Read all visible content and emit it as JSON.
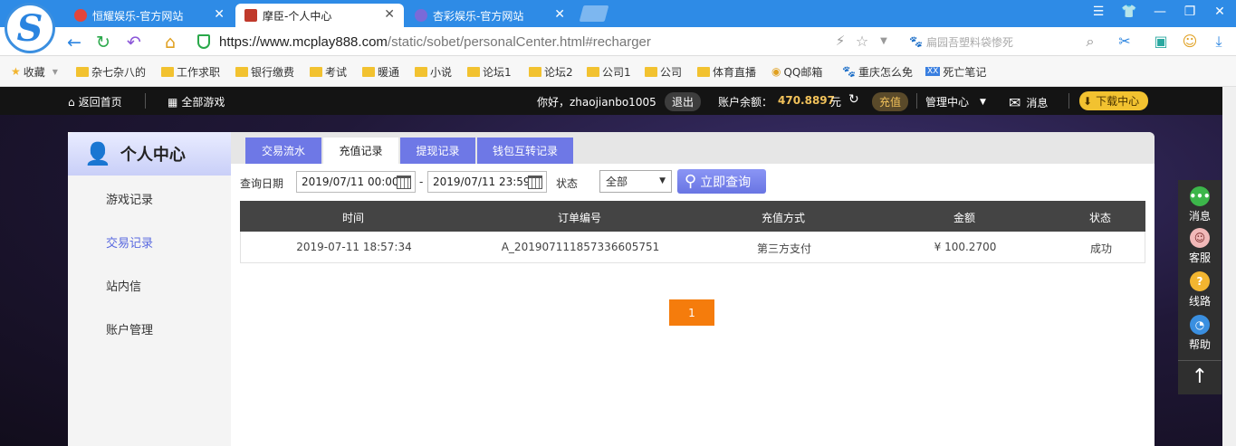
{
  "browser": {
    "logo_glyph": "S",
    "tabs": [
      {
        "label": "恒耀娱乐-官方网站",
        "close": "✕",
        "icon_color": "#e2453c"
      },
      {
        "label": "摩臣-个人中心",
        "close": "✕",
        "icon_color": "#c0392b"
      },
      {
        "label": "杏彩娱乐-官方网站",
        "close": "✕",
        "icon_color": "#7a6ad8"
      }
    ],
    "url": {
      "host": "https://www.mcplay888.com",
      "path": "/static/sobet/personalCenter.html#recharger"
    },
    "search_placeholder": "扁园吾塑料袋惨死",
    "bookmarks": [
      "收藏",
      "杂七杂八的",
      "工作求职",
      "银行缴费",
      "考试",
      "暖通",
      "小说",
      "论坛1",
      "论坛2",
      "公司1",
      "公司",
      "体育直播",
      "QQ邮箱",
      "重庆怎么免",
      "死亡笔记"
    ]
  },
  "sitenav": {
    "home": "返回首页",
    "all_games": "全部游戏",
    "greeting": "你好，zhaojianbo1005",
    "logout": "退出",
    "balance_label": "账户余额：",
    "balance": "470.8897",
    "currency": "元",
    "recharge": "充值",
    "manage": "管理中心",
    "messages": "消息",
    "download": "下载中心"
  },
  "left": {
    "title": "个人中心",
    "items": [
      "游戏记录",
      "交易记录",
      "站内信",
      "账户管理"
    ],
    "active_index": 1
  },
  "tabs": [
    "交易流水",
    "充值记录",
    "提现记录",
    "钱包互转记录"
  ],
  "active_tab": 1,
  "filter": {
    "date_label": "查询日期",
    "start": "2019/07/11 00:00",
    "sep": "-",
    "end": "2019/07/11 23:59",
    "status_label": "状态",
    "status_value": "全部",
    "query_button": "立即查询"
  },
  "table": {
    "headers": [
      "时间",
      "订单编号",
      "充值方式",
      "金额",
      "状态"
    ],
    "rows": [
      [
        "2019-07-11 18:57:34",
        "A_201907111857336605751",
        "第三方支付",
        "¥ 100.2700",
        "成功"
      ]
    ]
  },
  "pagination": {
    "current": "1"
  },
  "float": {
    "items": [
      "消息",
      "客服",
      "线路",
      "帮助"
    ],
    "top": "↑"
  },
  "colors": {
    "accent": "#6e78e6",
    "orange": "#f57c0c",
    "gold": "#f2c25a"
  }
}
